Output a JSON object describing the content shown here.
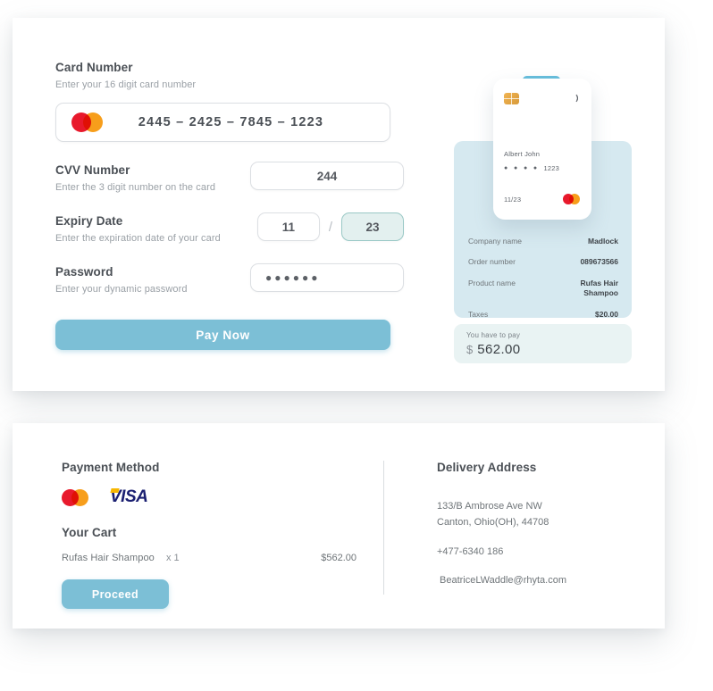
{
  "colors": {
    "accent": "#7cbfd6",
    "panel_blue": "#d6e9f0",
    "summary_bg": "#e9f3f3",
    "focus_teal": "#9ac9c6",
    "mastercard_red": "#e8192c",
    "mastercard_orange": "#f79e1b",
    "visa_blue": "#1a1f71",
    "visa_gold": "#f7b600"
  },
  "form": {
    "card_number": {
      "label": "Card Number",
      "hint": "Enter your 16 digit card number",
      "value": "2445  –  2425  –  7845  –  1223",
      "brand_icon": "mastercard-icon"
    },
    "cvv": {
      "label": "CVV Number",
      "hint": "Enter the 3 digit number on the card",
      "value": "244"
    },
    "expiry": {
      "label": "Expiry Date",
      "hint": "Enter the expiration date of your card",
      "month": "11",
      "separator": "/",
      "year": "23"
    },
    "password": {
      "label": "Password",
      "hint": "Enter your dynamic password",
      "value": "●●●●●●"
    },
    "submit_label": "Pay Now"
  },
  "card_preview": {
    "chip_icon": "emv-chip-icon",
    "contactless_icon": "contactless-icon",
    "holder_name": "Albert John",
    "masked_dots": "● ● ● ●",
    "last_four": "1223",
    "expiry": "11/23",
    "brand_icon": "mastercard-icon"
  },
  "order": {
    "rows": [
      {
        "key": "Company name",
        "value": "Madlock"
      },
      {
        "key": "Order number",
        "value": "089673566"
      },
      {
        "key": "Product name",
        "value": "Rufas Hair Shampoo"
      },
      {
        "key": "Taxes",
        "value": "$20.00"
      }
    ],
    "summary_label": "You have to pay",
    "summary_currency": "$",
    "summary_amount": "562.00"
  },
  "payment_method": {
    "title": "Payment Method",
    "brands": [
      "mastercard-icon",
      "visa-icon"
    ],
    "visa_text": "VISA"
  },
  "cart": {
    "title": "Your Cart",
    "items": [
      {
        "name": "Rufas Hair Shampoo",
        "qty": "x 1",
        "price": "$562.00"
      }
    ],
    "proceed_label": "Proceed"
  },
  "delivery": {
    "title": "Delivery Address",
    "street": "133/B Ambrose Ave NW",
    "city_state_zip": "Canton, Ohio(OH), 44708",
    "phone": "+477-6340 186",
    "email": "BeatriceLWaddle@rhyta.com"
  }
}
